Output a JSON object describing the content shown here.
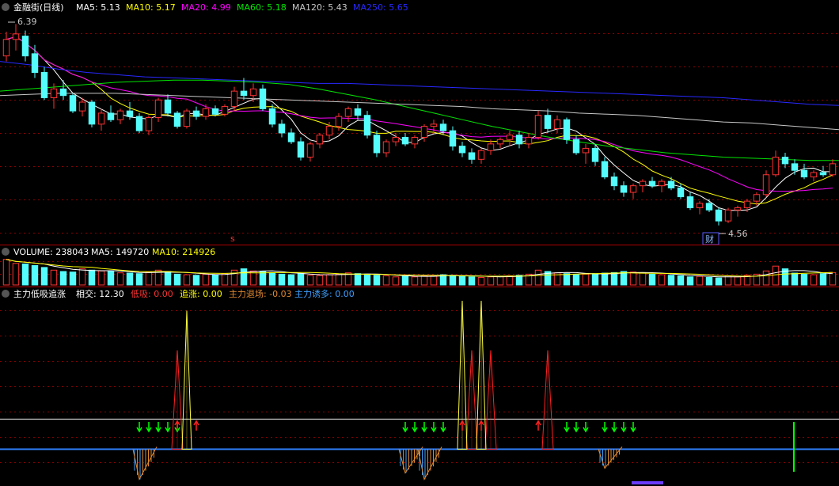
{
  "colors": {
    "up": "#ff3232",
    "down": "#54fcfc",
    "ma5": "#ffffff",
    "ma10": "#ffff00",
    "ma20": "#ff00ff",
    "ma60": "#00e600",
    "ma120": "#c8c8c8",
    "ma250": "#2828ff",
    "vol_ma10": "#ffff00",
    "divider": "#b00000",
    "grid": "#8b0000",
    "mark_red": "#ff2020",
    "mark_yellow": "#ffff40",
    "mark_blue": "#3da0ff",
    "mark_orange": "#e08830",
    "arrow_green": "#00ff00",
    "arrow_red": "#ff2020",
    "baseline": "#2f7fff",
    "refline": "#ffffff"
  },
  "main_panel": {
    "title": "金融街(日线)",
    "ma_labels": [
      {
        "name": "MA5",
        "value": "5.13",
        "color": "#ffffff"
      },
      {
        "name": "MA10",
        "value": "5.17",
        "color": "#ffff00"
      },
      {
        "name": "MA20",
        "value": "4.99",
        "color": "#ff00ff"
      },
      {
        "name": "MA60",
        "value": "5.18",
        "color": "#00e600"
      },
      {
        "name": "MA120",
        "value": "5.43",
        "color": "#c8c8c8"
      },
      {
        "name": "MA250",
        "value": "5.65",
        "color": "#2828ff"
      }
    ],
    "high_mark": "6.39",
    "low_mark": "4.56",
    "event_badge": "财",
    "s_mark": "s"
  },
  "volume_panel": {
    "labels": [
      {
        "name": "VOLUME",
        "value": "238043",
        "color": "#ffffff"
      },
      {
        "name": "MA5",
        "value": "149720",
        "color": "#ffffff"
      },
      {
        "name": "MA10",
        "value": "214926",
        "color": "#ffff00"
      }
    ]
  },
  "indicator_panel": {
    "title": "主力低吸追涨",
    "labels": [
      {
        "name": "相交",
        "value": "12.30",
        "color": "#ffffff"
      },
      {
        "name": "低吸",
        "value": "0.00",
        "color": "#ff3232"
      },
      {
        "name": "追涨",
        "value": "0.00",
        "color": "#ffff00"
      },
      {
        "name": "主力退场",
        "value": "-0.03",
        "color": "#e08830"
      },
      {
        "name": "主力诱多",
        "value": "0.00",
        "color": "#3da0ff"
      }
    ]
  },
  "chart_data": {
    "type": "candlestick",
    "price_range": [
      4.45,
      6.45
    ],
    "highest": 6.39,
    "lowest": 4.56,
    "candle_count": 88,
    "candles": [
      [
        6.1,
        6.32,
        6.05,
        6.25
      ],
      [
        6.25,
        6.39,
        6.15,
        6.3
      ],
      [
        6.28,
        6.33,
        6.05,
        6.1
      ],
      [
        6.12,
        6.2,
        5.9,
        5.95
      ],
      [
        5.95,
        6.0,
        5.7,
        5.72
      ],
      [
        5.72,
        5.85,
        5.62,
        5.8
      ],
      [
        5.8,
        5.88,
        5.7,
        5.74
      ],
      [
        5.74,
        5.76,
        5.58,
        5.6
      ],
      [
        5.6,
        5.72,
        5.55,
        5.68
      ],
      [
        5.68,
        5.7,
        5.45,
        5.48
      ],
      [
        5.48,
        5.62,
        5.42,
        5.58
      ],
      [
        5.58,
        5.65,
        5.5,
        5.52
      ],
      [
        5.52,
        5.62,
        5.48,
        5.6
      ],
      [
        5.6,
        5.68,
        5.52,
        5.55
      ],
      [
        5.55,
        5.58,
        5.4,
        5.42
      ],
      [
        5.42,
        5.56,
        5.38,
        5.54
      ],
      [
        5.54,
        5.72,
        5.5,
        5.7
      ],
      [
        5.7,
        5.75,
        5.55,
        5.58
      ],
      [
        5.58,
        5.6,
        5.44,
        5.46
      ],
      [
        5.46,
        5.62,
        5.44,
        5.6
      ],
      [
        5.6,
        5.64,
        5.52,
        5.55
      ],
      [
        5.55,
        5.66,
        5.52,
        5.62
      ],
      [
        5.62,
        5.65,
        5.55,
        5.57
      ],
      [
        5.57,
        5.66,
        5.55,
        5.64
      ],
      [
        5.64,
        5.82,
        5.6,
        5.78
      ],
      [
        5.78,
        5.9,
        5.7,
        5.74
      ],
      [
        5.74,
        5.85,
        5.68,
        5.8
      ],
      [
        5.8,
        5.84,
        5.6,
        5.62
      ],
      [
        5.62,
        5.66,
        5.45,
        5.48
      ],
      [
        5.48,
        5.52,
        5.36,
        5.4
      ],
      [
        5.4,
        5.44,
        5.3,
        5.32
      ],
      [
        5.32,
        5.36,
        5.15,
        5.18
      ],
      [
        5.18,
        5.32,
        5.14,
        5.3
      ],
      [
        5.3,
        5.4,
        5.26,
        5.38
      ],
      [
        5.38,
        5.5,
        5.34,
        5.46
      ],
      [
        5.46,
        5.58,
        5.42,
        5.55
      ],
      [
        5.55,
        5.64,
        5.5,
        5.62
      ],
      [
        5.62,
        5.66,
        5.52,
        5.56
      ],
      [
        5.56,
        5.6,
        5.35,
        5.38
      ],
      [
        5.38,
        5.42,
        5.18,
        5.22
      ],
      [
        5.22,
        5.34,
        5.18,
        5.32
      ],
      [
        5.32,
        5.4,
        5.28,
        5.36
      ],
      [
        5.36,
        5.4,
        5.28,
        5.3
      ],
      [
        5.3,
        5.38,
        5.26,
        5.36
      ],
      [
        5.36,
        5.48,
        5.32,
        5.46
      ],
      [
        5.46,
        5.52,
        5.4,
        5.48
      ],
      [
        5.48,
        5.52,
        5.38,
        5.42
      ],
      [
        5.42,
        5.46,
        5.24,
        5.28
      ],
      [
        5.28,
        5.32,
        5.18,
        5.22
      ],
      [
        5.22,
        5.26,
        5.12,
        5.16
      ],
      [
        5.16,
        5.26,
        5.12,
        5.24
      ],
      [
        5.24,
        5.34,
        5.2,
        5.3
      ],
      [
        5.3,
        5.36,
        5.26,
        5.34
      ],
      [
        5.34,
        5.42,
        5.28,
        5.38
      ],
      [
        5.38,
        5.42,
        5.26,
        5.3
      ],
      [
        5.3,
        5.4,
        5.26,
        5.36
      ],
      [
        5.36,
        5.6,
        5.34,
        5.56
      ],
      [
        5.56,
        5.62,
        5.4,
        5.44
      ],
      [
        5.44,
        5.56,
        5.4,
        5.52
      ],
      [
        5.52,
        5.54,
        5.3,
        5.34
      ],
      [
        5.34,
        5.38,
        5.2,
        5.22
      ],
      [
        5.22,
        5.3,
        5.12,
        5.26
      ],
      [
        5.26,
        5.3,
        5.1,
        5.14
      ],
      [
        5.14,
        5.18,
        4.98,
        5.0
      ],
      [
        5.0,
        5.04,
        4.88,
        4.92
      ],
      [
        4.92,
        4.96,
        4.82,
        4.86
      ],
      [
        4.86,
        4.94,
        4.8,
        4.92
      ],
      [
        4.92,
        4.98,
        4.86,
        4.96
      ],
      [
        4.96,
        5.0,
        4.9,
        4.92
      ],
      [
        4.92,
        4.98,
        4.86,
        4.96
      ],
      [
        4.96,
        5.0,
        4.88,
        4.9
      ],
      [
        4.9,
        4.94,
        4.8,
        4.82
      ],
      [
        4.82,
        4.86,
        4.7,
        4.72
      ],
      [
        4.72,
        4.78,
        4.66,
        4.76
      ],
      [
        4.76,
        4.8,
        4.68,
        4.7
      ],
      [
        4.7,
        4.72,
        4.56,
        4.6
      ],
      [
        4.6,
        4.72,
        4.58,
        4.7
      ],
      [
        4.7,
        4.74,
        4.64,
        4.72
      ],
      [
        4.72,
        4.8,
        4.68,
        4.78
      ],
      [
        4.78,
        4.86,
        4.74,
        4.84
      ],
      [
        4.84,
        5.06,
        4.82,
        5.02
      ],
      [
        5.02,
        5.24,
        5.0,
        5.18
      ],
      [
        5.18,
        5.22,
        5.08,
        5.12
      ],
      [
        5.12,
        5.16,
        5.02,
        5.06
      ],
      [
        5.06,
        5.12,
        4.98,
        5.0
      ],
      [
        5.0,
        5.06,
        4.96,
        5.04
      ],
      [
        5.04,
        5.1,
        5.0,
        5.02
      ],
      [
        5.02,
        5.16,
        5.0,
        5.12
      ]
    ],
    "ma_series": {
      "ma60": [
        5.78,
        5.8,
        5.82,
        5.84,
        5.86,
        5.87,
        5.88,
        5.88,
        5.87,
        5.86,
        5.84,
        5.8,
        5.75,
        5.7,
        5.64,
        5.58,
        5.52,
        5.46,
        5.41,
        5.36,
        5.32,
        5.28,
        5.25,
        5.22,
        5.2,
        5.18,
        5.17,
        5.16,
        5.15,
        5.15
      ],
      "ma120": [
        5.74,
        5.75,
        5.76,
        5.76,
        5.76,
        5.75,
        5.74,
        5.73,
        5.72,
        5.71,
        5.7,
        5.69,
        5.68,
        5.67,
        5.66,
        5.65,
        5.64,
        5.62,
        5.61,
        5.6,
        5.58,
        5.57,
        5.56,
        5.54,
        5.52,
        5.5,
        5.49,
        5.47,
        5.45,
        5.43
      ],
      "ma250": [
        6.05,
        6.02,
        5.98,
        5.95,
        5.93,
        5.91,
        5.9,
        5.89,
        5.88,
        5.87,
        5.86,
        5.85,
        5.85,
        5.84,
        5.83,
        5.82,
        5.81,
        5.8,
        5.79,
        5.78,
        5.77,
        5.76,
        5.75,
        5.74,
        5.73,
        5.72,
        5.7,
        5.68,
        5.66,
        5.65
      ]
    },
    "volume_values": [
      95,
      80,
      78,
      72,
      65,
      55,
      50,
      48,
      60,
      55,
      52,
      50,
      45,
      44,
      42,
      48,
      55,
      50,
      40,
      38,
      36,
      40,
      38,
      42,
      55,
      60,
      52,
      50,
      46,
      40,
      38,
      42,
      36,
      35,
      38,
      40,
      45,
      42,
      40,
      36,
      34,
      30,
      32,
      30,
      34,
      35,
      38,
      36,
      32,
      30,
      28,
      30,
      32,
      34,
      36,
      40,
      55,
      50,
      45,
      42,
      38,
      40,
      42,
      44,
      46,
      50,
      48,
      44,
      40,
      38,
      36,
      34,
      30,
      32,
      28,
      26,
      34,
      30,
      36,
      40,
      52,
      70,
      60,
      44,
      40,
      38,
      42,
      46
    ],
    "indicator": {
      "low_suck_peaks": [
        {
          "i": 18,
          "v": 100
        },
        {
          "i": 49,
          "v": 100
        },
        {
          "i": 51,
          "v": 100
        },
        {
          "i": 57,
          "v": 100
        }
      ],
      "chase_peaks": [
        {
          "i": 19,
          "v": 140
        },
        {
          "i": 48,
          "v": 150
        },
        {
          "i": 50,
          "v": 150
        }
      ],
      "exit_dips": [
        {
          "i": 14,
          "v": -38
        },
        {
          "i": 42,
          "v": -30
        },
        {
          "i": 44,
          "v": -38
        },
        {
          "i": 63,
          "v": -24
        }
      ],
      "green_down_arrows": [
        14,
        15,
        16,
        17,
        18,
        42,
        43,
        44,
        45,
        46,
        59,
        60,
        61,
        63,
        64,
        65,
        66
      ],
      "red_up_arrows": [
        18,
        20,
        48,
        50,
        56
      ]
    }
  }
}
